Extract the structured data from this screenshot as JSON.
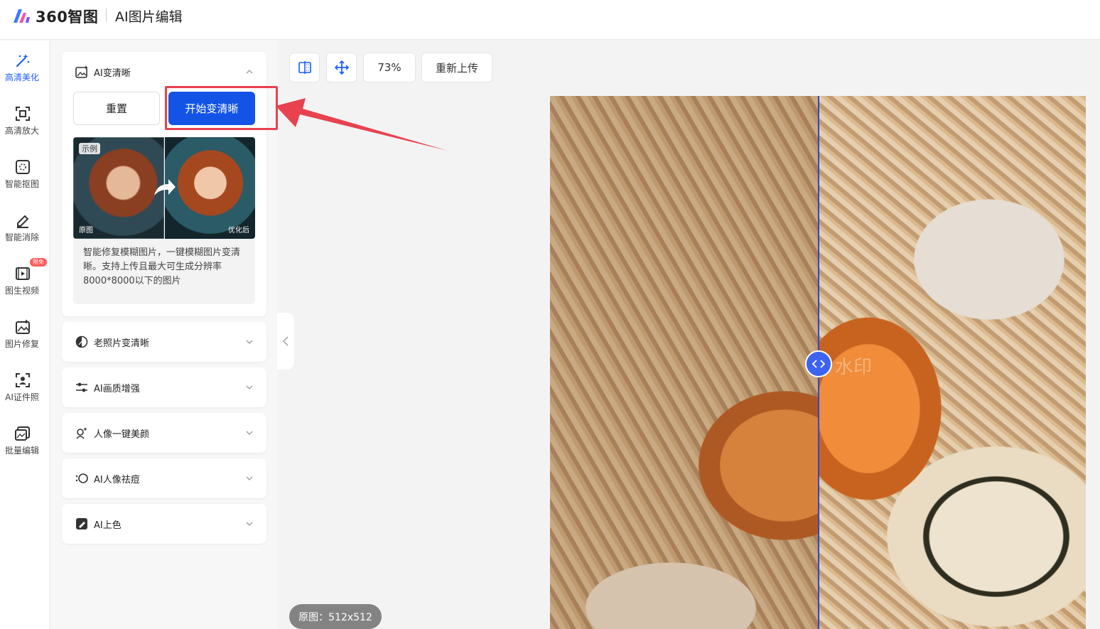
{
  "header": {
    "brand": "360智图",
    "title": "AI图片编辑"
  },
  "rail": {
    "items": [
      {
        "label": "高清美化",
        "icon": "magic-wand-icon",
        "active": true
      },
      {
        "label": "高清放大",
        "icon": "enlarge-icon"
      },
      {
        "label": "智能抠图",
        "icon": "cutout-icon"
      },
      {
        "label": "智能消除",
        "icon": "eraser-icon"
      },
      {
        "label": "图生视频",
        "icon": "video-icon",
        "badge": "限免"
      },
      {
        "label": "图片修复",
        "icon": "image-repair-icon"
      },
      {
        "label": "AI证件照",
        "icon": "id-photo-icon"
      },
      {
        "label": "批量编辑",
        "icon": "batch-edit-icon"
      }
    ]
  },
  "panel": {
    "enhance": {
      "title": "AI变清晰",
      "reset_label": "重置",
      "start_label": "开始变清晰",
      "sample_tag": "示例",
      "before_label": "原图",
      "after_label": "优化后",
      "description": "智能修复模糊图片，一键模糊图片变清晰。支持上传且最大可生成分辨率8000*8000以下的图片"
    },
    "sections": [
      {
        "title": "老照片变清晰",
        "icon": "old-photo-icon"
      },
      {
        "title": "AI画质增强",
        "icon": "sliders-icon"
      },
      {
        "title": "人像一键美颜",
        "icon": "beauty-icon"
      },
      {
        "title": "AI人像祛痘",
        "icon": "acne-icon"
      },
      {
        "title": "AI上色",
        "icon": "colorize-icon"
      }
    ]
  },
  "toolbar": {
    "zoom": "73%",
    "reupload_label": "重新上传"
  },
  "canvas": {
    "watermark": "水印",
    "info": "原图：512x512"
  },
  "colors": {
    "accent": "#1354e6",
    "highlight": "#e8424f"
  }
}
